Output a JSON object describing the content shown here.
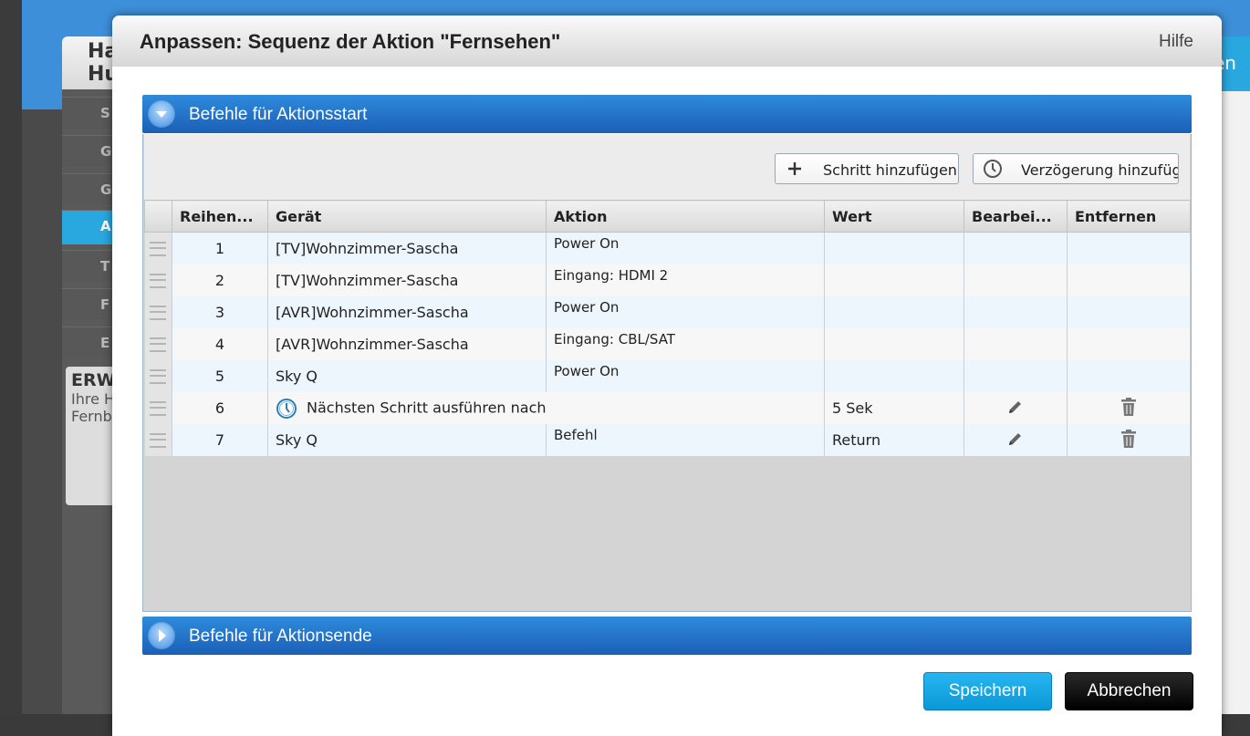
{
  "background": {
    "panel_title": "Ha\nHu",
    "nav_items": [
      "S",
      "G",
      "G",
      "A",
      "T",
      "F",
      "E"
    ],
    "card_title": "ERW",
    "card_text": "Ihre H\nFernb",
    "right_tab": "en"
  },
  "modal": {
    "title": "Anpassen: Sequenz der Aktion \"Fernsehen\"",
    "help": "Hilfe"
  },
  "start_section": {
    "label": "Befehle für Aktionsstart",
    "add_step_label": "Schritt hinzufügen",
    "add_delay_label": "Verzögerung hinzufüg",
    "columns": [
      "Reihen...",
      "Gerät",
      "Aktion",
      "Wert",
      "Bearbei...",
      "Entfernen"
    ],
    "rows": [
      {
        "order": "1",
        "device": "[TV]Wohnzimmer-Sascha",
        "action": "Power On",
        "value": ""
      },
      {
        "order": "2",
        "device": "[TV]Wohnzimmer-Sascha",
        "action": "Eingang: HDMI 2",
        "value": ""
      },
      {
        "order": "3",
        "device": "[AVR]Wohnzimmer-Sascha",
        "action": "Power On",
        "value": ""
      },
      {
        "order": "4",
        "device": "[AVR]Wohnzimmer-Sascha",
        "action": "Eingang: CBL/SAT",
        "value": ""
      },
      {
        "order": "5",
        "device": "Sky Q",
        "action": "Power On",
        "value": ""
      },
      {
        "order": "6",
        "delay_text": "Nächsten Schritt ausführen nach",
        "value": "5 Sek"
      },
      {
        "order": "7",
        "device": "Sky Q",
        "action": "Befehl",
        "value": "Return"
      }
    ]
  },
  "end_section": {
    "label": "Befehle für Aktionsende"
  },
  "footer": {
    "save_label": "Speichern",
    "cancel_label": "Abbrechen"
  },
  "colors": {
    "accent_blue": "#1a6fc9",
    "save_button": "#1aa7e5",
    "cancel_button": "#000000"
  }
}
